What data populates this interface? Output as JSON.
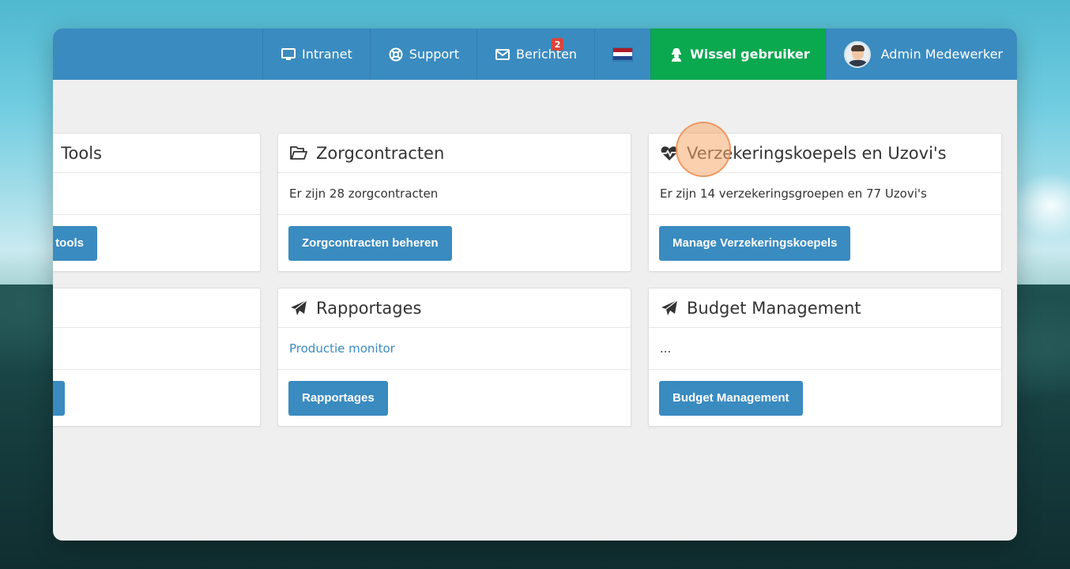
{
  "nav": {
    "intranet": "Intranet",
    "support": "Support",
    "berichten": "Berichten",
    "berichten_badge": "2",
    "wissel_gebruiker": "Wissel gebruiker",
    "user_name": "Admin Medewerker"
  },
  "cards": {
    "tools": {
      "title": "Tools",
      "button": "tools"
    },
    "zorgcontracten": {
      "title": "Zorgcontracten",
      "body": "Er zijn 28 zorgcontracten",
      "button": "Zorgcontracten beheren"
    },
    "verzekering": {
      "title": "Verzekeringskoepels en Uzovi's",
      "body": "Er zijn 14 verzekeringsgroepen en 77 Uzovi's",
      "button": "Manage Verzekeringskoepels"
    },
    "rapportages": {
      "title": "Rapportages",
      "body_link": "Productie monitor",
      "button": "Rapportages"
    },
    "budget": {
      "title": "Budget Management",
      "body": "...",
      "button": "Budget Management"
    }
  },
  "colors": {
    "primary": "#3a8bc0",
    "success": "#0aa84f",
    "badge": "#d9453b"
  }
}
